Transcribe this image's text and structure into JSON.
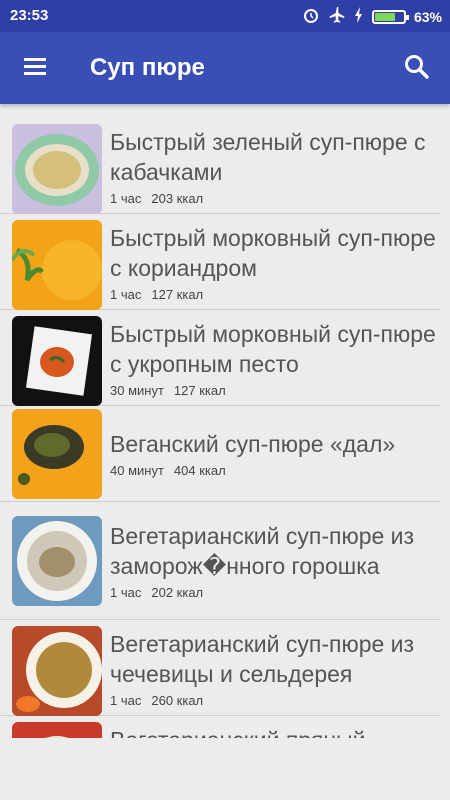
{
  "status": {
    "time": "23:53",
    "battery": "63%"
  },
  "app": {
    "title": "Суп пюре"
  },
  "icons": {
    "menu": "hamburger-icon",
    "search": "search-icon"
  },
  "recipes": [
    {
      "title": "Быстрый зеленый суп-пюре с кабачками",
      "time": "1 час",
      "kcal": "203 ккал"
    },
    {
      "title": "Быстрый морковный суп-пюре с кориандром",
      "time": "1 час",
      "kcal": "127 ккал"
    },
    {
      "title": "Быстрый морковный суп-пюре с укропным песто",
      "time": "30 минут",
      "kcal": "127 ккал"
    },
    {
      "title": "Веганский суп-пюре «дал»",
      "time": "40 минут",
      "kcal": "404 ккал"
    },
    {
      "title": "Вегетарианский суп-пюре из заморож�нного горошка",
      "time": "1 час",
      "kcal": "202 ккал"
    },
    {
      "title": "Вегетарианский суп-пюре из чечевицы и сельдерея",
      "time": "1 час",
      "kcal": "260 ккал"
    },
    {
      "title": "Вегетарианский пряный",
      "time": "",
      "kcal": ""
    }
  ],
  "colors": {
    "statusbar": "#2f3fa6",
    "appbar": "#3a4fb5",
    "background": "#ececec"
  }
}
